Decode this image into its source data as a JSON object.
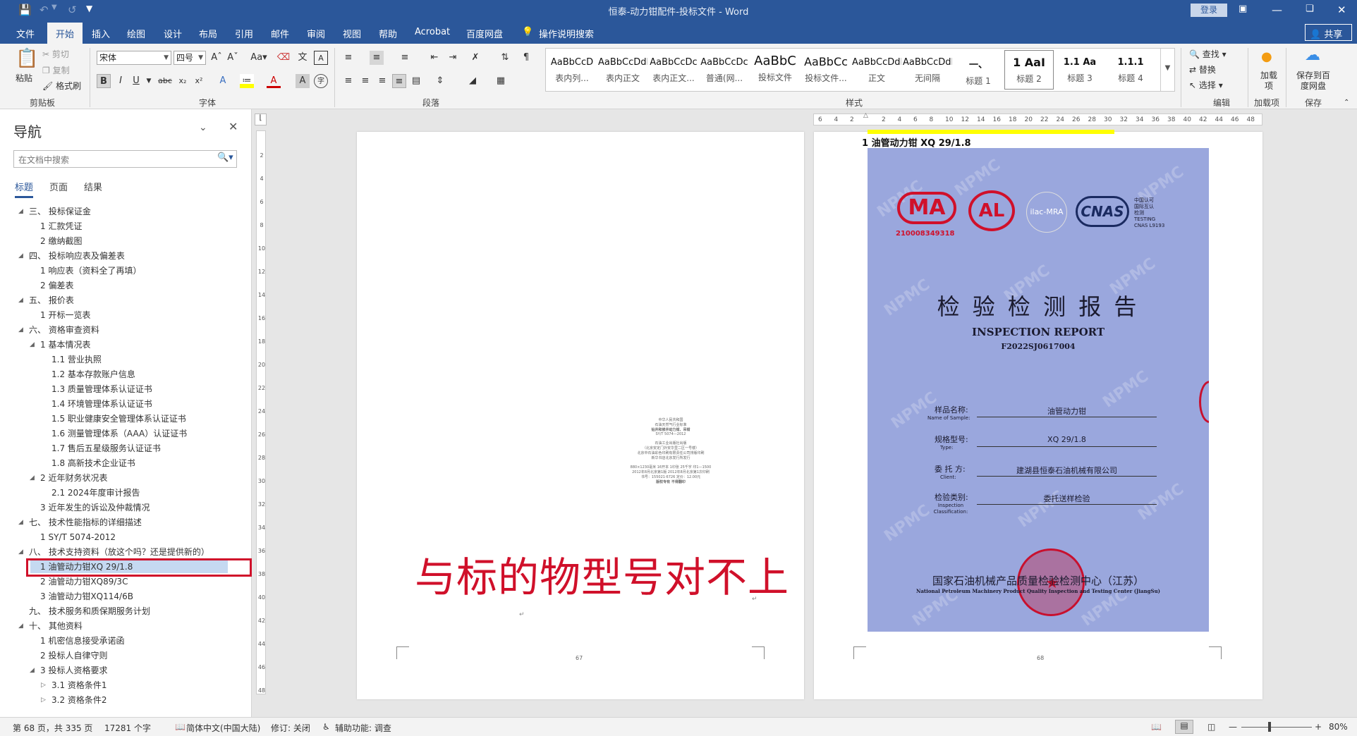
{
  "window": {
    "title": "恒泰-动力钳配件-投标文件 - Word",
    "login": "登录"
  },
  "menu": {
    "items": [
      "文件",
      "开始",
      "插入",
      "绘图",
      "设计",
      "布局",
      "引用",
      "邮件",
      "审阅",
      "视图",
      "帮助",
      "Acrobat",
      "百度网盘"
    ],
    "search": "操作说明搜索",
    "share": "共享"
  },
  "ribbon": {
    "clipboard": {
      "paste": "粘贴",
      "cut": "剪切",
      "copy": "复制",
      "format_painter": "格式刷",
      "label": "剪贴板"
    },
    "font": {
      "name": "宋体",
      "size": "四号",
      "label": "字体"
    },
    "paragraph": {
      "label": "段落"
    },
    "styles": {
      "label": "样式",
      "items": [
        {
          "sample": "AaBbCcD",
          "name": "表内列..."
        },
        {
          "sample": "AaBbCcDdI",
          "name": "表内正文"
        },
        {
          "sample": "AaBbCcDc",
          "name": "表内正文..."
        },
        {
          "sample": "AaBbCcDc",
          "name": "普通(网..."
        },
        {
          "sample": "AaBbC",
          "name": "投标文件"
        },
        {
          "sample": "AaBbCc",
          "name": "投标文件..."
        },
        {
          "sample": "AaBbCcDdI",
          "name": "正文"
        },
        {
          "sample": "AaBbCcDdI",
          "name": "无间隔"
        },
        {
          "sample": "一、",
          "name": "标题 1"
        },
        {
          "sample": "1   AaI",
          "name": "标题 2"
        },
        {
          "sample": "1.1  Aa",
          "name": "标题 3"
        },
        {
          "sample": "1.1.1",
          "name": "标题 4"
        }
      ]
    },
    "editing": {
      "find": "查找",
      "replace": "替换",
      "select": "选择",
      "label": "编辑"
    },
    "addins": {
      "label": "加载项",
      "btn": "加载项"
    },
    "save": {
      "btn": "保存到百度网盘",
      "label": "保存"
    }
  },
  "nav": {
    "title": "导航",
    "search_placeholder": "在文档中搜索",
    "tabs": [
      "标题",
      "页面",
      "结果"
    ],
    "items": [
      "三、 投标保证金",
      "1 汇款凭证",
      "2 缴纳截图",
      "四、 投标响应表及偏差表",
      "1 响应表（资料全了再填）",
      "2 偏差表",
      "五、 报价表",
      "1 开标一览表",
      "六、 资格审查资料",
      "1 基本情况表",
      "1.1 营业执照",
      "1.2 基本存款账户信息",
      "1.3 质量管理体系认证证书",
      "1.4 环境管理体系认证证书",
      "1.5 职业健康安全管理体系认证证书",
      "1.6 测量管理体系（AAA）认证证书",
      "1.7 售后五星级服务认证证书",
      "1.8 高新技术企业证书",
      "2 近年财务状况表",
      "2.1 2024年度审计报告",
      "3 近年发生的诉讼及仲裁情况",
      "七、 技术性能指标的详细描述",
      "1 SY/T 5074-2012",
      "八、 技术支持资料（放这个吗？还是提供新的）",
      "1 油管动力钳XQ 29/1.8",
      "2 油管动力钳XQ89/3C",
      "3 油管动力钳XQ114/6B",
      "九、 技术服务和质保期服务计划",
      "十、 其他资料",
      "1 机密信息接受承诺函",
      "2 投标人自律守则",
      "3 投标人资格要求",
      "3.1 资格条件1",
      "3.2 资格条件2"
    ]
  },
  "doc": {
    "annotation": "与标的物型号对不上",
    "page_left_no": "67",
    "page_right_no": "68",
    "heading": "1  油管动力钳 XQ 29/1.8",
    "small_text": [
      "中华人民共和国",
      "石油天然气行业标准",
      "钻井和修井动力钳、吊钳",
      "SY/T 5074—2012",
      "",
      "石油工业出版社出版",
      "（北京安定门外安华里二区一号楼）",
      "北京中石油彩色印刷有限责任公司排版印刷",
      "新华书店北京发行所发行",
      "",
      "880×1230毫米 16开本 1印张 25千字 印1—1500",
      "2012年8月北京第1版 2012年8月北京第1次印刷",
      "书号：155021·6726  定价：12.00元",
      "版权专有  不得翻印"
    ],
    "cert": {
      "title": "检 验 检 测 报 告",
      "title_en": "INSPECTION  REPORT",
      "number": "F2022SJ0617004",
      "ma_no": "210008349318",
      "cnas_side": [
        "中国认可",
        "国际互认",
        "检测",
        "TESTING",
        "CNAS L9193"
      ],
      "fields": [
        {
          "label": "样品名称:",
          "label_en": "Name of Sample:",
          "value": "油管动力钳"
        },
        {
          "label": "规格型号:",
          "label_en": "Type:",
          "value": "XQ  29/1.8"
        },
        {
          "label": "委 托 方:",
          "label_en": "Client:",
          "value": "建湖县恒泰石油机械有限公司"
        },
        {
          "label": "检验类别:",
          "label_en": "Inspection Classification:",
          "value": "委托送样检验"
        }
      ],
      "center": "国家石油机械产品质量检验检测中心（江苏）",
      "center_en": "National Petroleum Machinery Product Quality Inspection and Testing Center (JiangSu)"
    }
  },
  "status": {
    "page": "第 68 页，共 335 页",
    "words": "17281 个字",
    "lang": "简体中文(中国大陆)",
    "track": "修订: 关闭",
    "access": "辅助功能: 调查",
    "zoom": "80%"
  }
}
